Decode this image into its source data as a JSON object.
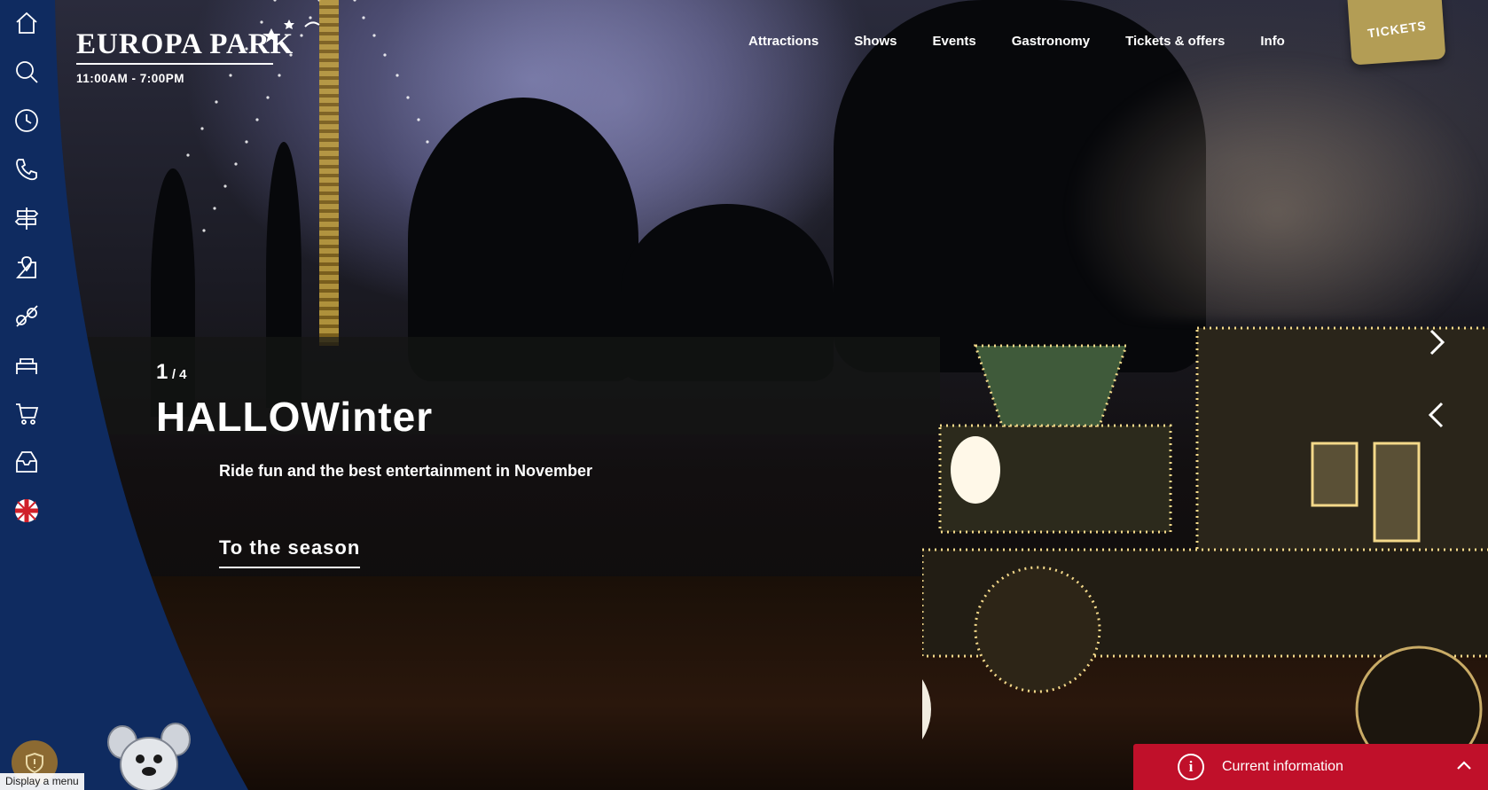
{
  "logo": {
    "text": "EUROPA PARK",
    "hours": "11:00AM - 7:00PM"
  },
  "nav": {
    "items": [
      {
        "label": "Attractions"
      },
      {
        "label": "Shows"
      },
      {
        "label": "Events"
      },
      {
        "label": "Gastronomy"
      },
      {
        "label": "Tickets & offers"
      },
      {
        "label": "Info"
      }
    ],
    "tickets_label": "TICKETS"
  },
  "sidebar": {
    "icons": [
      "home-icon",
      "search-icon",
      "clock-icon",
      "phone-icon",
      "signpost-icon",
      "map-icon",
      "rides-icon",
      "hotel-icon",
      "cart-icon",
      "inbox-icon",
      "uk-flag-icon"
    ],
    "menu_hint": "Display a menu"
  },
  "slide": {
    "current": "1",
    "total": "/ 4",
    "title": "HALLOWinter",
    "subtitle": "Ride fun and the best entertainment in November",
    "cta": "To the season"
  },
  "info_bar": {
    "label": "Current information"
  },
  "colors": {
    "sidebar": "#0f2b60",
    "info_bar": "#c0102a",
    "tickets": "#b39d55"
  }
}
